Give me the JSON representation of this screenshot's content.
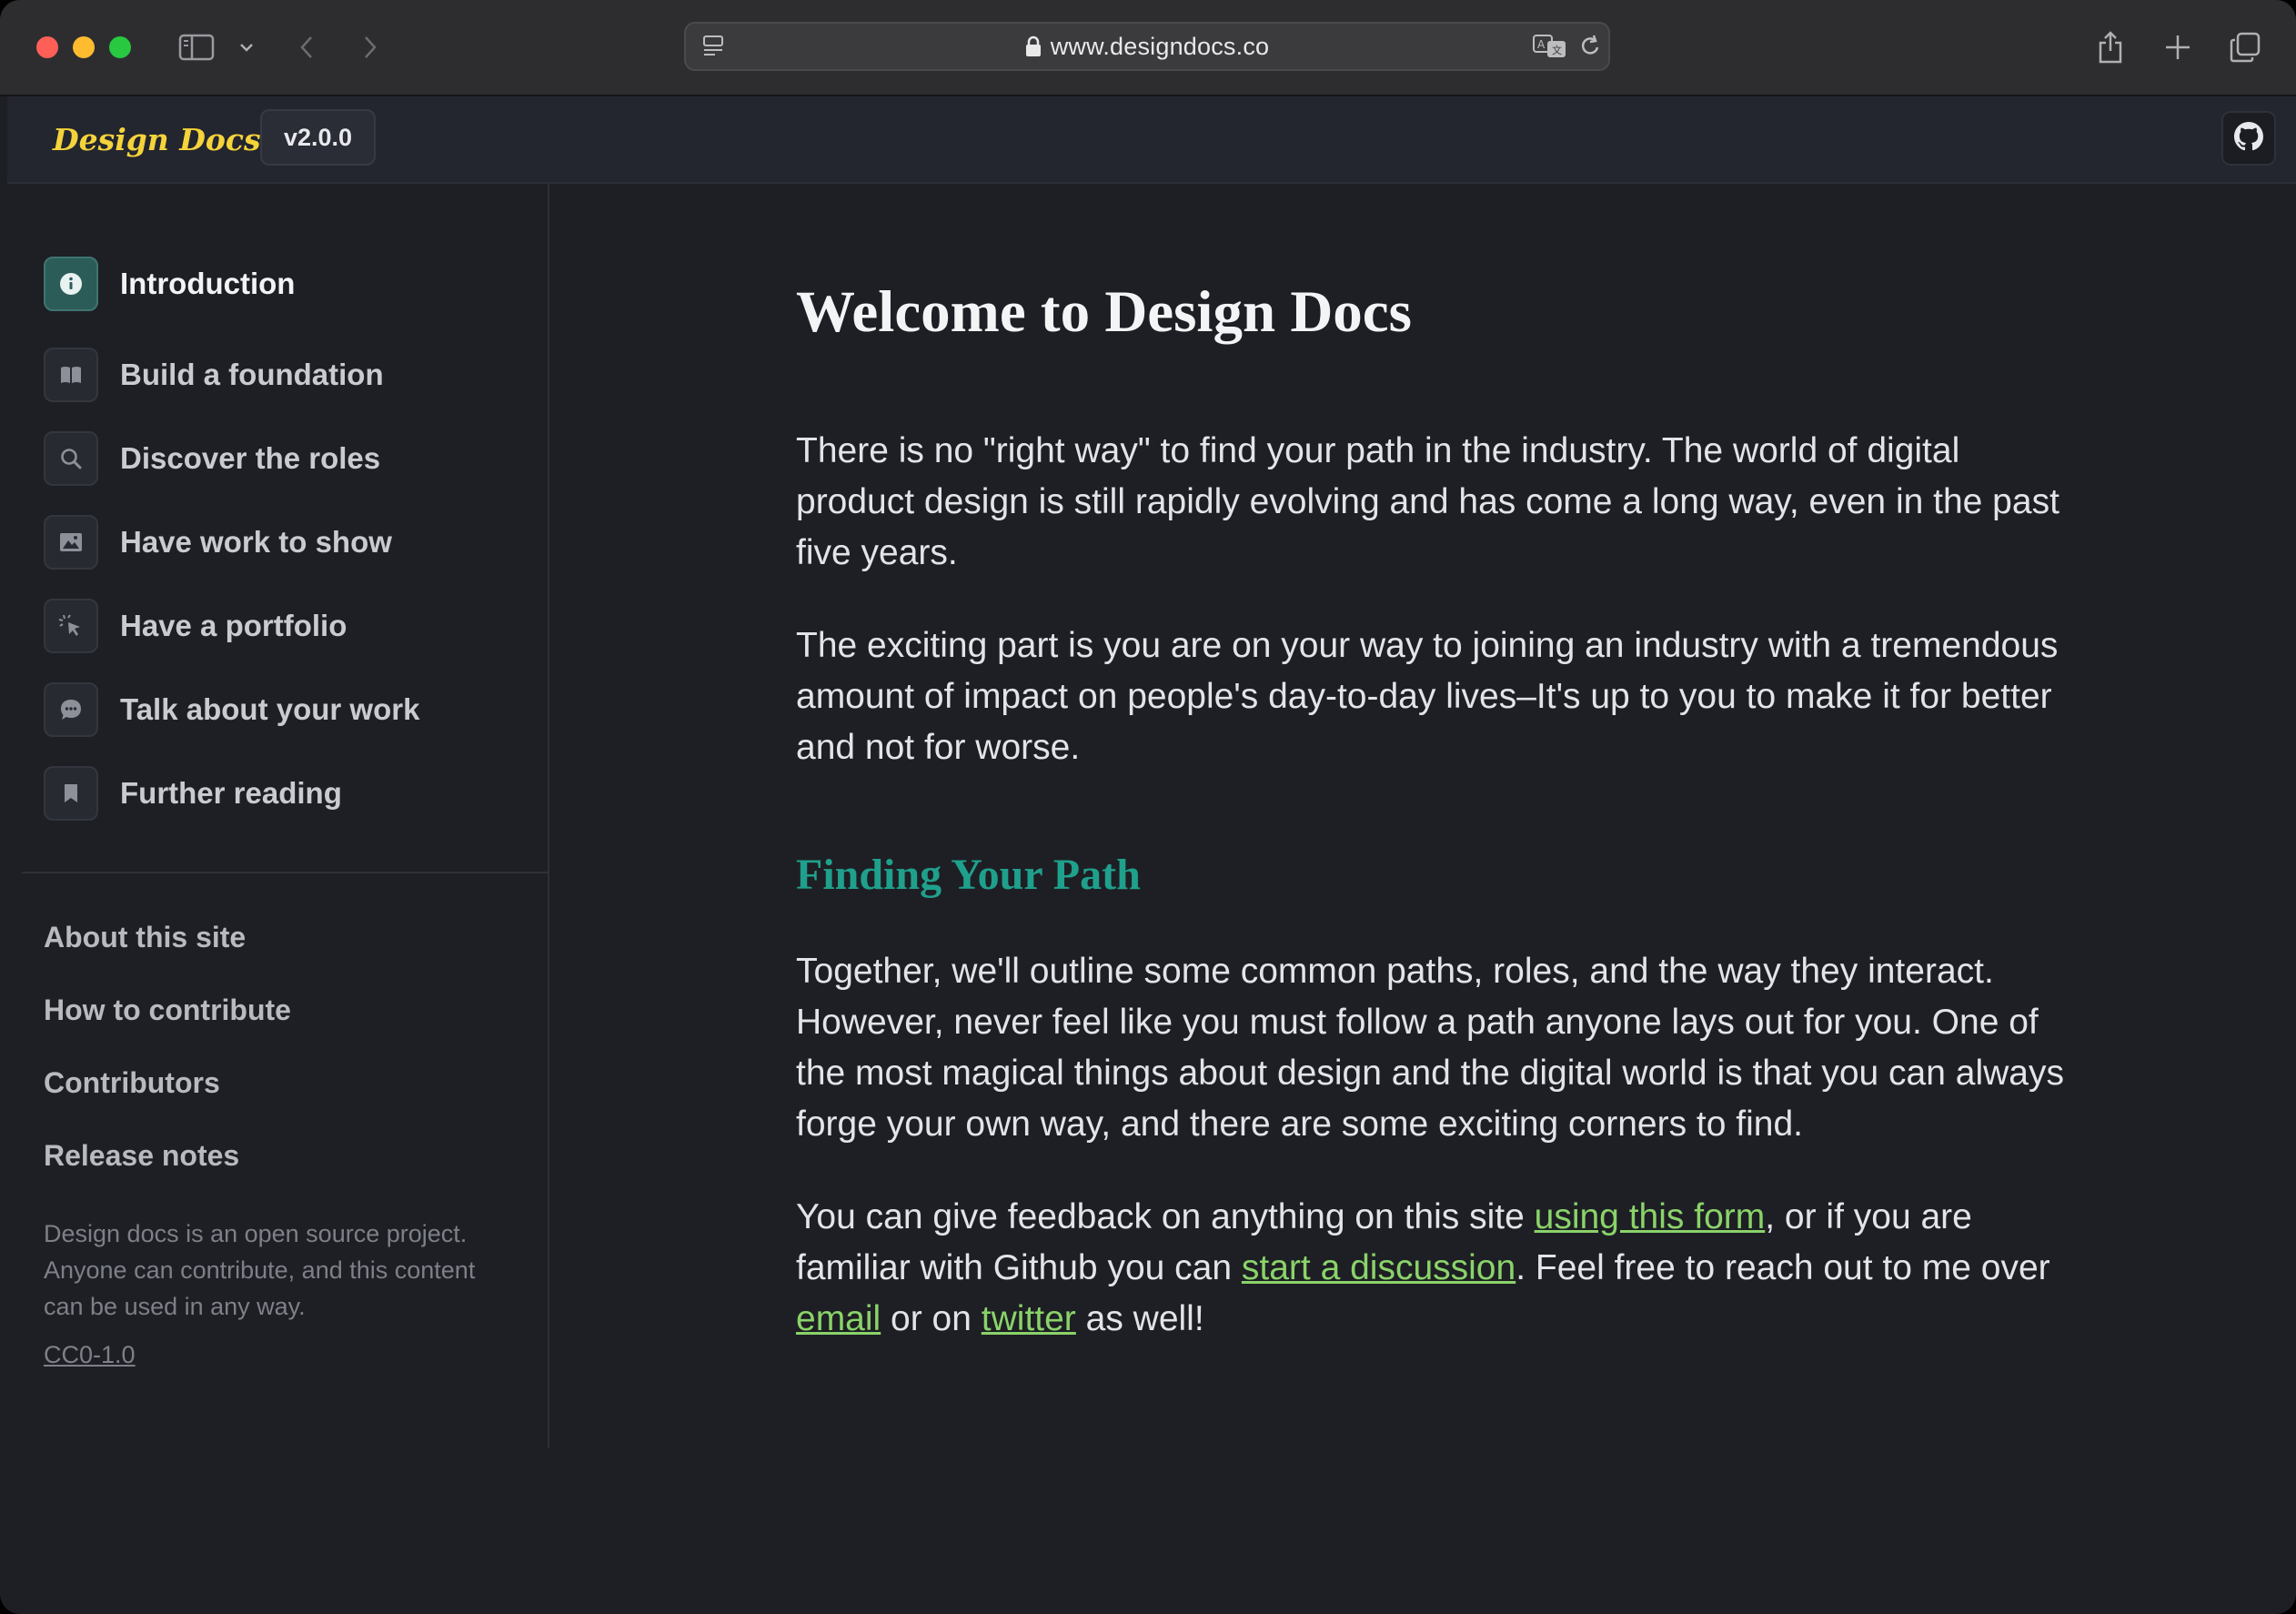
{
  "browser": {
    "url": "www.designdocs.co"
  },
  "header": {
    "logo": "Design Docs",
    "version": "v2.0.0"
  },
  "sidebar": {
    "items": [
      {
        "label": "Introduction",
        "icon": "info-icon",
        "active": true
      },
      {
        "label": "Build a foundation",
        "icon": "book-icon"
      },
      {
        "label": "Discover the roles",
        "icon": "search-icon"
      },
      {
        "label": "Have work to show",
        "icon": "image-icon"
      },
      {
        "label": "Have a portfolio",
        "icon": "cursor-click-icon"
      },
      {
        "label": "Talk about your work",
        "icon": "chat-bubble-icon"
      },
      {
        "label": "Further reading",
        "icon": "bookmark-icon"
      }
    ],
    "footer_links": [
      "About this site",
      "How to contribute",
      "Contributors",
      "Release notes"
    ],
    "description": "Design docs is an open source project. Anyone can contribute, and this content can be used in any way.",
    "license": "CC0-1.0"
  },
  "main": {
    "title": "Welcome to Design Docs",
    "intro_p1": "There is no \"right way\" to find your path in the industry. The world of digital product design is still rapidly evolving and has come a long way, even in the past five years.",
    "intro_p2": "The exciting part is you are on your way to joining an industry with a tremendous amount of impact on people's day-to-day lives–It's up to you to make it for better and not for worse.",
    "section_title": "Finding Your Path",
    "section_p1": "Together, we'll outline some common paths, roles, and the way they interact. However, never feel like you must follow a path anyone lays out for you. One of the most magical things about design and the digital world is that you can always forge your own way, and there are some exciting corners to find.",
    "feedback": {
      "t1": "You can give feedback on anything on this site ",
      "link1": "using this form",
      "t2": ", or if you are familiar with Github you can ",
      "link2": "start a discussion",
      "t3": ". Feel free to reach out to me over ",
      "link3": "email",
      "t4": " or on ",
      "link4": "twitter",
      "t5": " as well!"
    }
  },
  "colors": {
    "accent_heading": "#1fa08c",
    "link": "#8ad36a",
    "logo": "#f5d33b",
    "active_icon_bg": "#2c5c58"
  }
}
